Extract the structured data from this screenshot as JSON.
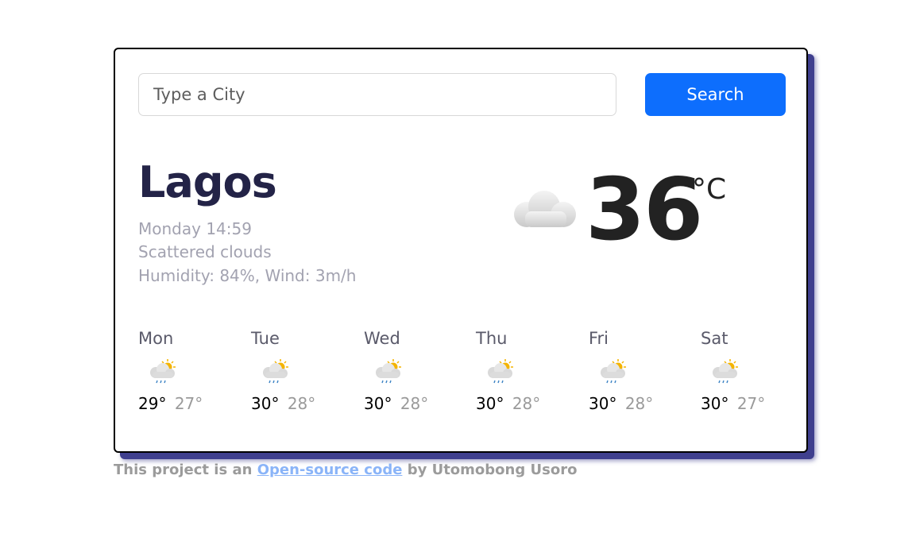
{
  "search": {
    "placeholder": "Type a City",
    "value": "",
    "button_label": "Search"
  },
  "current": {
    "city": "Lagos",
    "datetime": "Monday 14:59",
    "description": "Scattered clouds",
    "details": "Humidity: 84%, Wind: 3m/h",
    "temperature": "36",
    "unit": "°C",
    "icon": "cloud-icon"
  },
  "forecast": [
    {
      "day": "Mon",
      "max": "29°",
      "min": "27°",
      "icon": "sun-cloud-rain-icon"
    },
    {
      "day": "Tue",
      "max": "30°",
      "min": "28°",
      "icon": "sun-cloud-rain-icon"
    },
    {
      "day": "Wed",
      "max": "30°",
      "min": "28°",
      "icon": "sun-cloud-rain-icon"
    },
    {
      "day": "Thu",
      "max": "30°",
      "min": "28°",
      "icon": "sun-cloud-rain-icon"
    },
    {
      "day": "Fri",
      "max": "30°",
      "min": "28°",
      "icon": "sun-cloud-rain-icon"
    },
    {
      "day": "Sat",
      "max": "30°",
      "min": "27°",
      "icon": "sun-cloud-rain-icon"
    }
  ],
  "footer": {
    "prefix": "This project is an",
    "link_text": "Open-source code",
    "suffix": "by Utomobong Usoro"
  },
  "colors": {
    "accent": "#0d6efd",
    "city": "#232347",
    "shadow": "#3f3f8e",
    "link": "#8ab4f8"
  }
}
